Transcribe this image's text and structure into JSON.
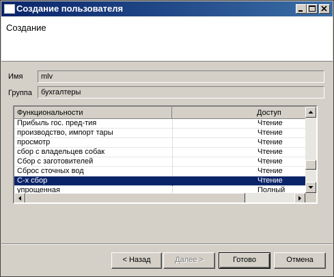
{
  "window": {
    "title": "Создание пользователя"
  },
  "header": {
    "title": "Создание"
  },
  "form": {
    "name_label": "Имя",
    "name_value": "mlv",
    "group_label": "Группа",
    "group_value": "бухгалтеры"
  },
  "grid": {
    "columns": [
      "Функциональности",
      "Доступ"
    ],
    "rows": [
      {
        "name": "Прибыль гос. пред-тия",
        "access": "Чтение"
      },
      {
        "name": "производство, импорт тары",
        "access": "Чтение"
      },
      {
        "name": "просмотр",
        "access": "Чтение"
      },
      {
        "name": "сбор с владельцев собак",
        "access": "Чтение"
      },
      {
        "name": "Сбор с заготовителей",
        "access": "Чтение"
      },
      {
        "name": "Сброс сточных вод",
        "access": "Чтение"
      },
      {
        "name": "С-х сбор",
        "access": "Чтение",
        "selected": true
      },
      {
        "name": "упрощенная",
        "access": "Полный"
      }
    ]
  },
  "buttons": {
    "back": "< Назад",
    "next": "Далее >",
    "finish": "Готово",
    "cancel": "Отмена"
  }
}
